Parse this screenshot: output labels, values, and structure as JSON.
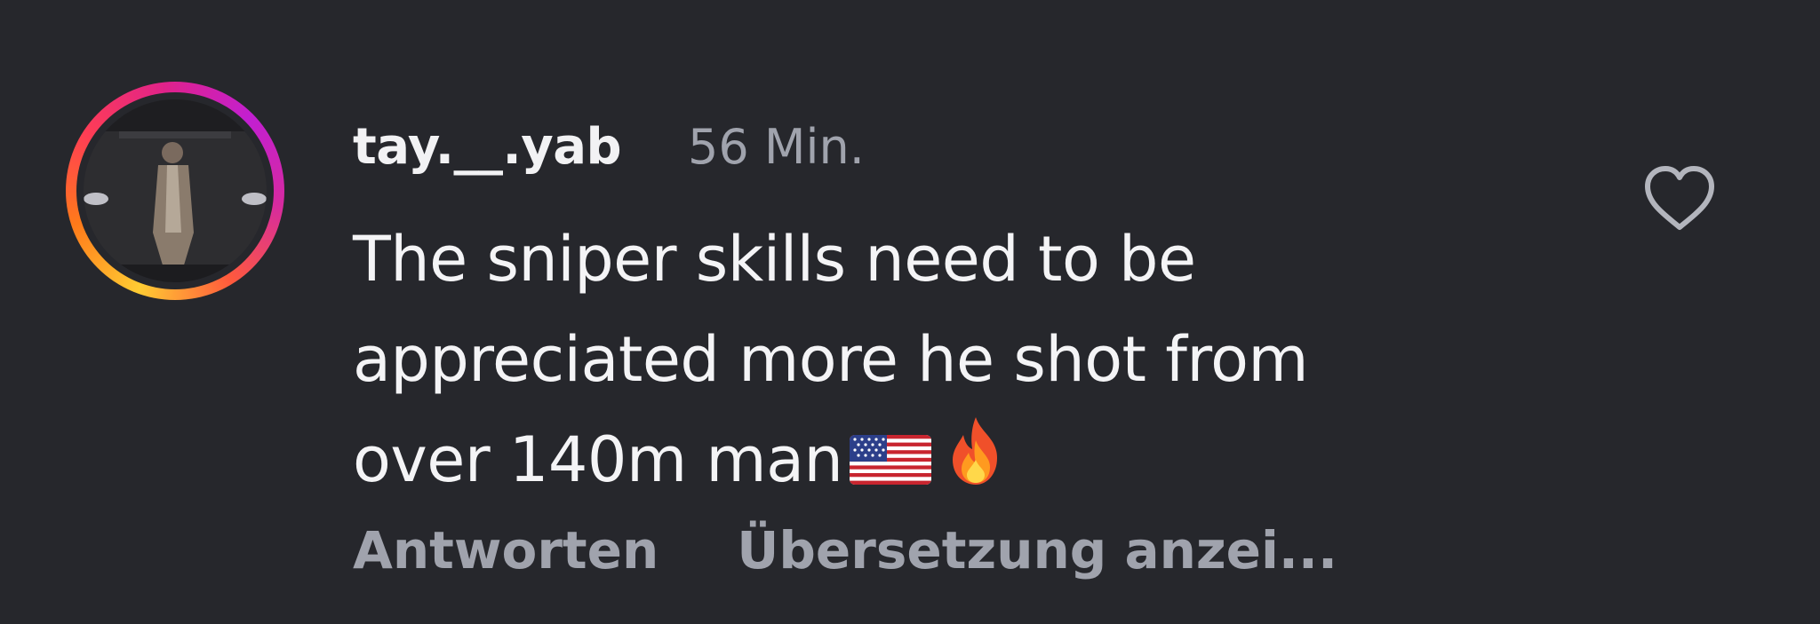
{
  "comment": {
    "username": "tay.__.yab",
    "timestamp": "56 Min.",
    "lines": [
      "The sniper skills need to be",
      "appreciated more he shot from",
      "over 140m man"
    ],
    "trailing_emoji": [
      "us-flag-emoji",
      "fire-emoji"
    ],
    "liked": false
  },
  "actions": {
    "reply_label": "Antworten",
    "translate_label": "Übersetzung anzei..."
  },
  "colors": {
    "background": "#26272c",
    "primary_text": "#f2f2f4",
    "secondary_text": "#a0a3ad",
    "story_ring": [
      "#ffcc33",
      "#ff7a1a",
      "#e0228a",
      "#c21fd1"
    ]
  }
}
